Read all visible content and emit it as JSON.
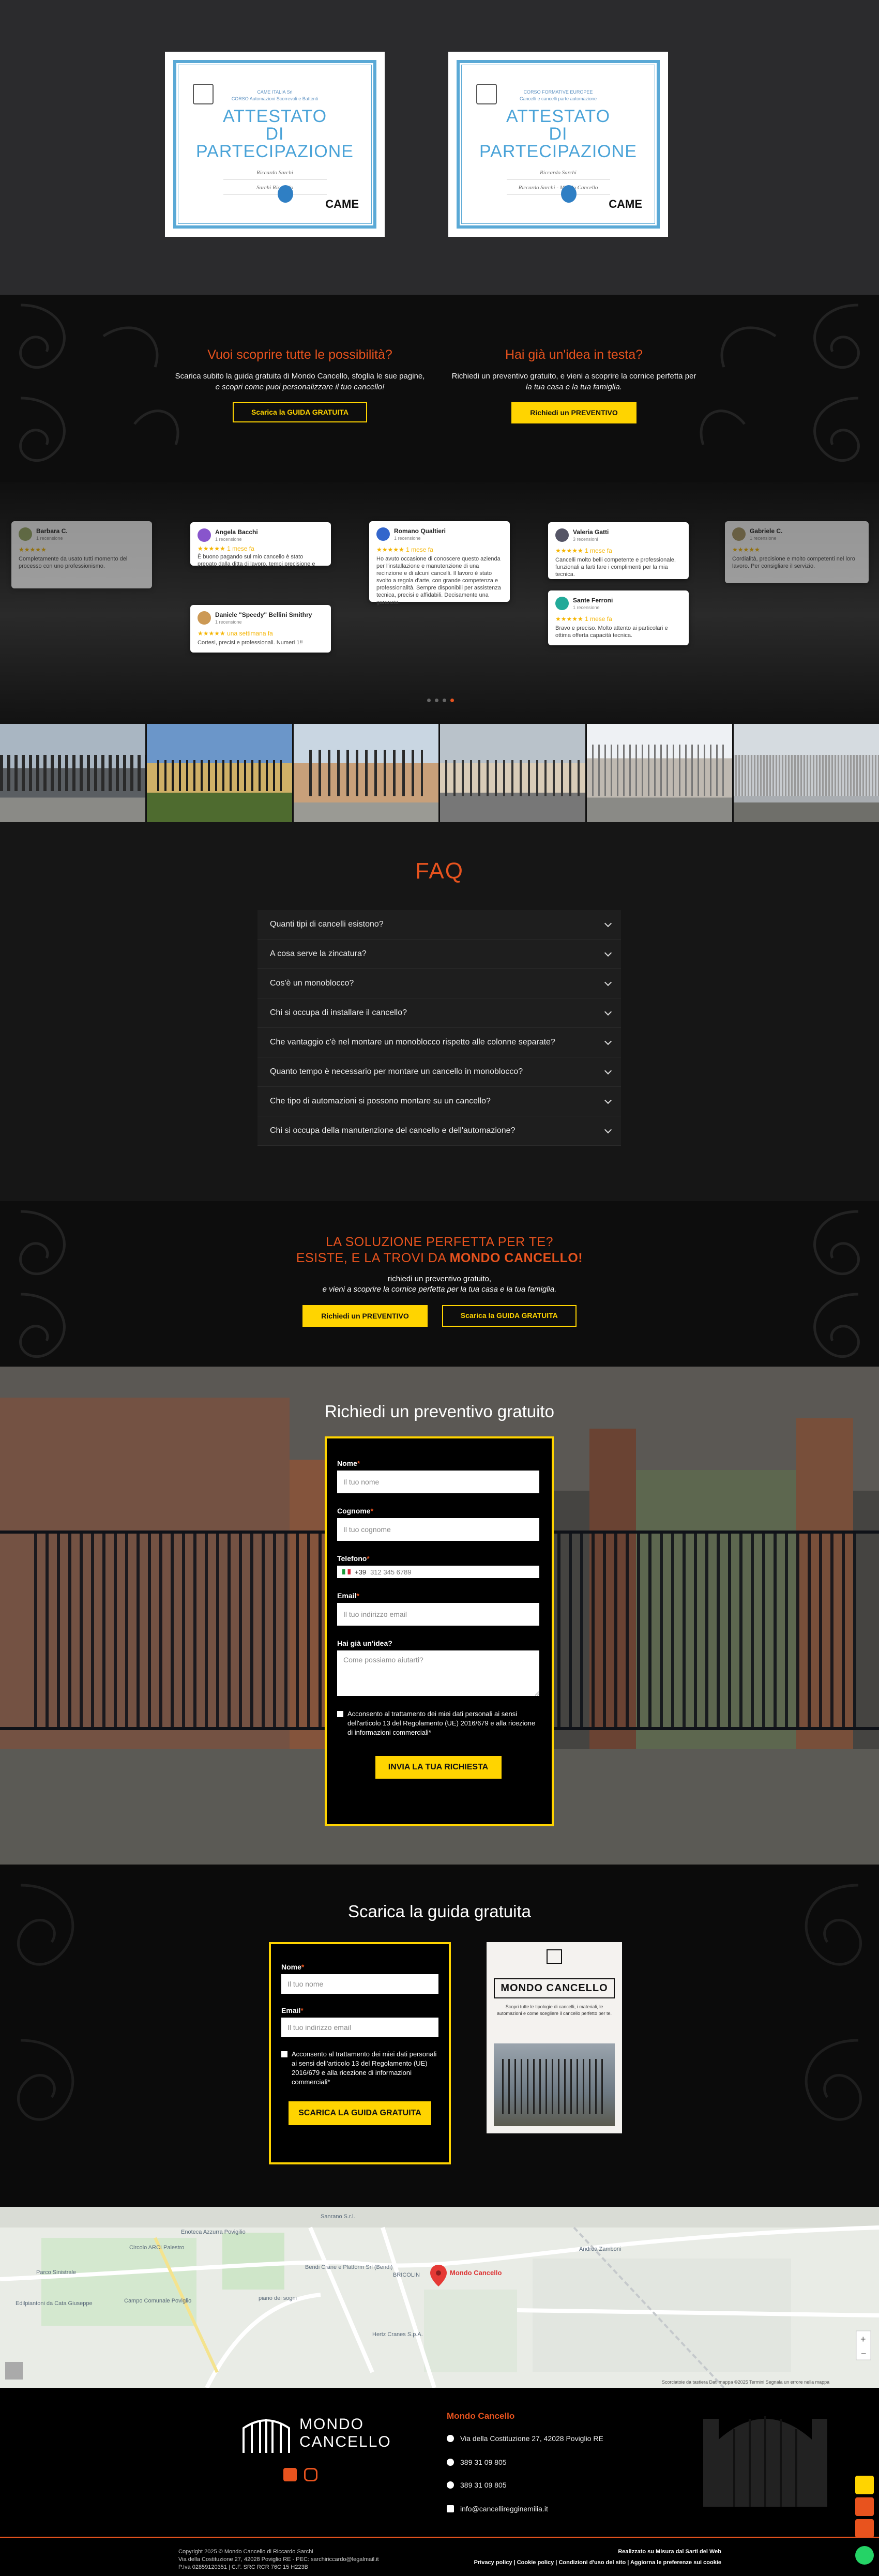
{
  "certificates": [
    {
      "header": "CAME ITALIA Srl\nCORSO Automazioni Scorrevoli e Battenti",
      "title_1": "ATTESTATO",
      "title_2": "DI PARTECIPAZIONE",
      "person": "Riccardo Sarchi",
      "org": "Sarchi Riccardo",
      "brand": "CAME"
    },
    {
      "header": "CORSO FORMATIVE EUROPEE\nCancelli e cancelli parte automazione",
      "title_1": "ATTESTATO",
      "title_2": "DI PARTECIPAZIONE",
      "person": "Riccardo Sarchi",
      "org": "Riccardo Sarchi - Mondo Cancello",
      "brand": "CAME"
    }
  ],
  "cta1": {
    "left_title": "Vuoi scoprire tutte le possibilità?",
    "left_text_1": "Scarica subito la guida gratuita di Mondo Cancello, sfoglia le sue pagine,",
    "left_text_2": "e scopri come puoi personalizzare il tuo cancello!",
    "left_button": "Scarica la GUIDA GRATUITA",
    "right_title": "Hai già un'idea in testa?",
    "right_text_1": "Richiedi un preventivo gratuito, e vieni a scoprire la cornice perfetta per",
    "right_text_2": "la tua casa e la tua famiglia.",
    "right_button": "Richiedi un PREVENTIVO"
  },
  "reviews": [
    {
      "name": "Barbara C.",
      "sub": "1 recensione",
      "stars": "★★★★★",
      "text": "Completamente da usato tutti momento del processo con uno professionismo.",
      "color": "#9a6"
    },
    {
      "name": "Angela Bacchi",
      "sub": "1 recensione",
      "stars": "★★★★★  1 mese fa",
      "text": "È buono pagando sul mio cancello è stato prepato dalla ditta di lavoro, tempi precisione e l'ordine e la pulizia.",
      "color": "#8855cc"
    },
    {
      "name": "Romano Qualtieri",
      "sub": "1 recensione",
      "stars": "★★★★★  1 mese fa",
      "text": "Ho avuto occasione di conoscere questo azienda per l'installazione e manutenzione di una recinzione e di alcuni cancelli. Il lavoro è stato svolto a regola d'arte, con grande competenza e professionalità. Sempre disponibili per assistenza tecnica, precisi e affidabili. Decisamente una garanzia.",
      "color": "#3366cc"
    },
    {
      "name": "Valeria Gatti",
      "sub": "3 recensioni",
      "stars": "★★★★★  1 mese fa",
      "text": "Cancelli molto belli competente e professionale, funzionali a farti fare i complimenti per la mia tecnica.",
      "color": "#556"
    },
    {
      "name": "Gabriele C.",
      "sub": "1 recensione",
      "stars": "★★★★★",
      "text": "Cordialità, precisione e molto competenti nel loro lavoro. Per consigliare il servizio.",
      "color": "#a96"
    },
    {
      "name": "Daniele \"Speedy\" Bellini Smithry",
      "sub": "1 recensione",
      "stars": "★★★★★  una settimana fa",
      "text": "Cortesi, precisi e professionali. Numeri 1!!",
      "color": "#c95"
    },
    {
      "name": "Sante Ferroni",
      "sub": "1 recensione",
      "stars": "★★★★★  1 mese fa",
      "text": "Bravo e preciso. Molto attento ai particolari e ottima offerta capacità tecnica.",
      "color": "#2a9"
    }
  ],
  "faq": {
    "title": "FAQ",
    "items": [
      "Quanti tipi di cancelli esistono?",
      "A cosa serve la zincatura?",
      "Cos'è un monoblocco?",
      "Chi si occupa di installare il cancello?",
      "Che vantaggio c'è nel montare un monoblocco rispetto alle colonne separate?",
      "Quanto tempo è necessario per montare un cancello in monoblocco?",
      "Che tipo di automazioni si possono montare su un cancello?",
      "Chi si occupa della manutenzione del cancello e dell'automazione?"
    ]
  },
  "cta2": {
    "line1": "LA SOLUZIONE PERFETTA PER TE?",
    "line2a": "ESISTE, E LA TROVI DA ",
    "line2b": "MONDO CANCELLO!",
    "text1": "richiedi un preventivo gratuito,",
    "text2": "e vieni a scoprire la cornice perfetta per la tua casa e la tua famiglia.",
    "btn_preventivo": "Richiedi un PREVENTIVO",
    "btn_guida": "Scarica la GUIDA GRATUITA"
  },
  "form_quote": {
    "title": "Richiedi un preventivo gratuito",
    "name_label": "Nome",
    "name_ph": "Il tuo nome",
    "surname_label": "Cognome",
    "surname_ph": "Il tuo cognome",
    "phone_label": "Telefono",
    "phone_prefix": "+39",
    "phone_ph": "312 345 6789",
    "email_label": "Email",
    "email_ph": "Il tuo indirizzo email",
    "idea_label": "Hai già un'idea?",
    "idea_ph": "Come possiamo aiutarti?",
    "consent": "Acconsento al trattamento dei miei dati personali ai sensi dell'articolo 13 del Regolamento (UE) 2016/679 e alla ricezione di informazioni commerciali*",
    "submit": "INVIA LA TUA RICHIESTA"
  },
  "form_guide": {
    "title": "Scarica la guida gratuita",
    "name_label": "Nome",
    "name_ph": "Il tuo nome",
    "email_label": "Email",
    "email_ph": "Il tuo indirizzo email",
    "consent": "Acconsento al trattamento dei miei dati personali ai sensi dell'articolo 13 del Regolamento (UE) 2016/679 e alla ricezione di informazioni commerciali*",
    "submit": "SCARICA LA GUIDA GRATUITA",
    "book_brand": "MONDO CANCELLO",
    "book_text": "Scopri tutte le tipologie di cancelli, i materiali, le automazioni e come scegliere il cancello perfetto per te."
  },
  "map": {
    "pin_label": "Mondo Cancello",
    "places": [
      "Circolo ARCI Palestro",
      "Enoteca Azzurra Povigilio",
      "Parco Sinistrale",
      "Edilpiantoni da Cata Giuseppe",
      "Campo Comunale Poviglio",
      "Bendi Crane e Platform Srl (Bendi)",
      "BRICOLIN",
      "Sanrano S.r.l.",
      "Andrea Zamboni",
      "Hertz Cranes S.p.A.",
      "piano dei sogni"
    ],
    "attribution": "Scorciatoie da tastiera  Dati mappa ©2025  Termini  Segnala un errore nella mappa"
  },
  "footer": {
    "brand_1": "MONDO",
    "brand_2": "CANCELLO",
    "col_title": "Mondo Cancello",
    "address": "Via della Costituzione 27, 42028 Poviglio RE",
    "phone1": "389 31 09 805",
    "phone2": "389 31 09 805",
    "email": "info@cancelliregginemilia.it",
    "copyright": "Copyright 2025 © Mondo Cancello di Riccardo Sarchi",
    "legal": "Via della Costituzione 27, 42028 Poviglio RE - PEC: sarchiriccardo@legalmail.it",
    "vat": "P.Iva 02859120351 | C.F. SRC RCR 76C 15 H223B",
    "made_by": "Realizzato su Misura dal Sarti del Web",
    "links": "Privacy policy | Cookie policy | Condizioni d'uso del sito | Aggiorna le preferenze sui cookie"
  },
  "colors": {
    "accent": "#e8531e",
    "yellow": "#ffd400",
    "bg": "#0d0d0d"
  }
}
